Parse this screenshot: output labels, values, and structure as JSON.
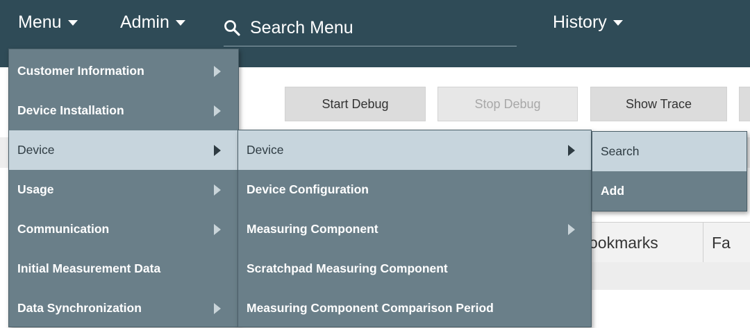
{
  "topbar": {
    "menu_label": "Menu",
    "admin_label": "Admin",
    "search_placeholder": "Search Menu",
    "history_label": "History"
  },
  "toolbar": {
    "start_debug": "Start Debug",
    "stop_debug": "Stop Debug",
    "show_trace": "Show Trace"
  },
  "tabs": {
    "bookmarks_partial": "ookmarks",
    "next_partial": "Fa"
  },
  "main_menu": {
    "items": [
      {
        "label": "Customer Information",
        "has_submenu": true
      },
      {
        "label": "Device Installation",
        "has_submenu": true
      },
      {
        "label": "Device",
        "has_submenu": true,
        "active": true
      },
      {
        "label": "Usage",
        "has_submenu": true
      },
      {
        "label": "Communication",
        "has_submenu": true
      },
      {
        "label": "Initial Measurement Data",
        "has_submenu": false
      },
      {
        "label": "Data Synchronization",
        "has_submenu": true
      }
    ]
  },
  "device_menu": {
    "items": [
      {
        "label": "Device",
        "has_submenu": true,
        "active": true
      },
      {
        "label": "Device Configuration",
        "has_submenu": false
      },
      {
        "label": "Measuring Component",
        "has_submenu": true
      },
      {
        "label": "Scratchpad Measuring Component",
        "has_submenu": false
      },
      {
        "label": "Measuring Component Comparison Period",
        "has_submenu": false
      }
    ]
  },
  "device_submenu": {
    "items": [
      {
        "label": "Search",
        "active": true
      },
      {
        "label": "Add",
        "active": false
      }
    ]
  },
  "colors": {
    "topbar": "#2f4b57",
    "menu_bg": "#6a7f89",
    "menu_active": "#c7d5dd"
  }
}
